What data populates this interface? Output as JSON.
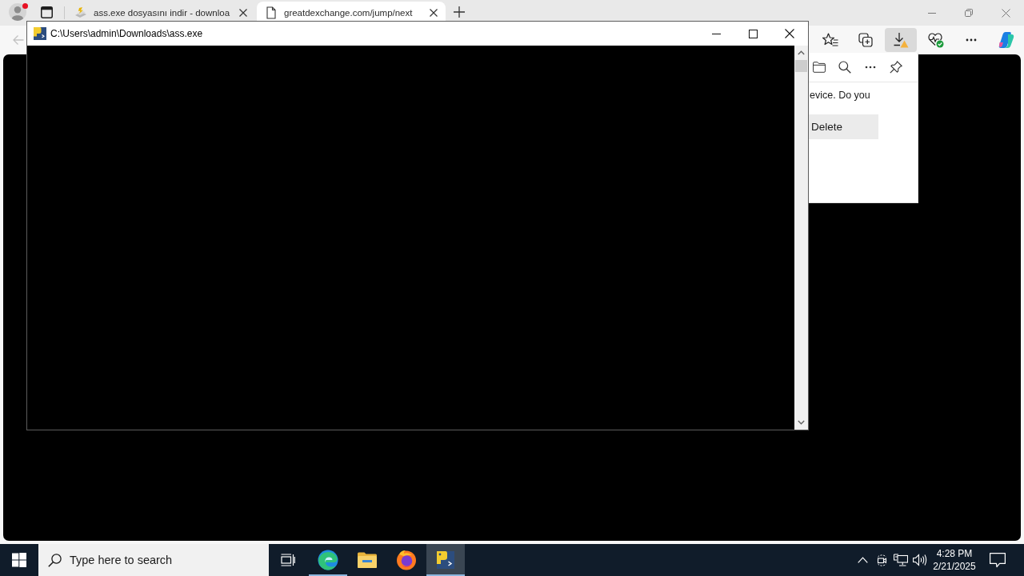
{
  "browser": {
    "tabs": [
      {
        "kind": "download",
        "title": "ass.exe dosyasını indir - downloa",
        "selected": false
      },
      {
        "kind": "page",
        "title": "greatdexchange.com/jump/next",
        "selected": true
      }
    ],
    "back_button": {
      "disabled": true
    },
    "toolbar_buttons": [
      {
        "kind": "favorites",
        "selected": false
      },
      {
        "kind": "collections",
        "selected": false
      },
      {
        "kind": "downloads",
        "selected": true
      },
      {
        "kind": "essentials",
        "selected": false
      },
      {
        "kind": "more",
        "selected": false
      },
      {
        "kind": "copilot",
        "selected": false
      }
    ],
    "downloads_panel": {
      "message": "evice. Do you",
      "button": "Delete"
    }
  },
  "console_window": {
    "title": "C:\\Users\\admin\\Downloads\\ass.exe"
  },
  "taskbar": {
    "search": {
      "placeholder": "Type here to search"
    },
    "apps": [
      {
        "kind": "edge",
        "running": true,
        "active": false
      },
      {
        "kind": "file-explorer",
        "running": false,
        "active": false
      },
      {
        "kind": "firefox",
        "running": false,
        "active": false
      },
      {
        "kind": "console",
        "running": true,
        "active": true
      }
    ],
    "clock": {
      "time": "4:28 PM",
      "date": "2/21/2025"
    }
  }
}
